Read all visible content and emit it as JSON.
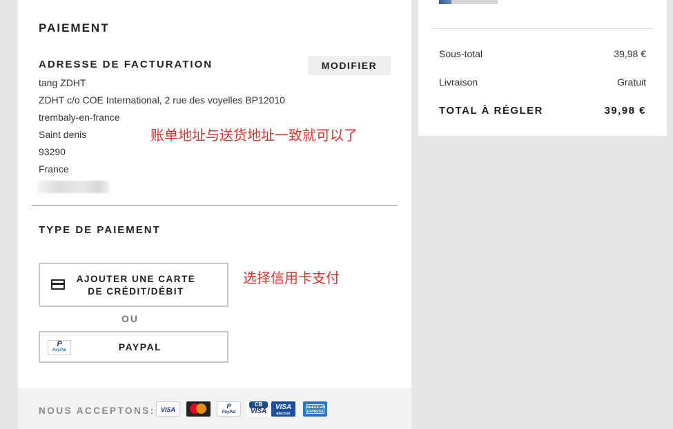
{
  "payment": {
    "title": "PAIEMENT",
    "billing": {
      "title": "ADRESSE DE FACTURATION",
      "modify_label": "MODIFIER",
      "lines": [
        "tang ZDHT",
        "ZDHT c/o COE International, 2 rue des voyelles BP12010",
        "trembaly-en-france",
        "Saint denis",
        "93290",
        "France"
      ]
    },
    "annotations": {
      "billing_note": "账单地址与送货地址一致就可以了",
      "card_note": "选择信用卡支付"
    },
    "type": {
      "title": "TYPE DE PAIEMENT",
      "card_label": "AJOUTER UNE CARTE DE CRÉDIT/DÉBIT",
      "card_icon": "credit-card-icon",
      "or_label": "OU",
      "paypal_label": "PAYPAL",
      "paypal_icon": "paypal-icon"
    },
    "accept": {
      "label": "NOUS ACCEPTONS:",
      "logos": [
        "VISA",
        "Mastercard",
        "PayPal",
        "CB VISA",
        "VISA Electron",
        "American Express"
      ],
      "visa_text": "VISA",
      "pp_p": "P",
      "pp_text": "PayPal",
      "cb_text": "CB",
      "cb_visa_text": "VISA",
      "ve_text": "VISA",
      "ve_sub": "Electron",
      "amex_text": "AMERICAN EXPRESS"
    }
  },
  "summary": {
    "subtotal_label": "Sous-total",
    "subtotal_value": "39,98 €",
    "shipping_label": "Livraison",
    "shipping_value": "Gratuit",
    "total_label": "TOTAL À RÉGLER",
    "total_value": "39,98 €"
  },
  "colors": {
    "annotation": "#e0322c",
    "background": "#e6e6e6",
    "panel": "#ffffff"
  }
}
